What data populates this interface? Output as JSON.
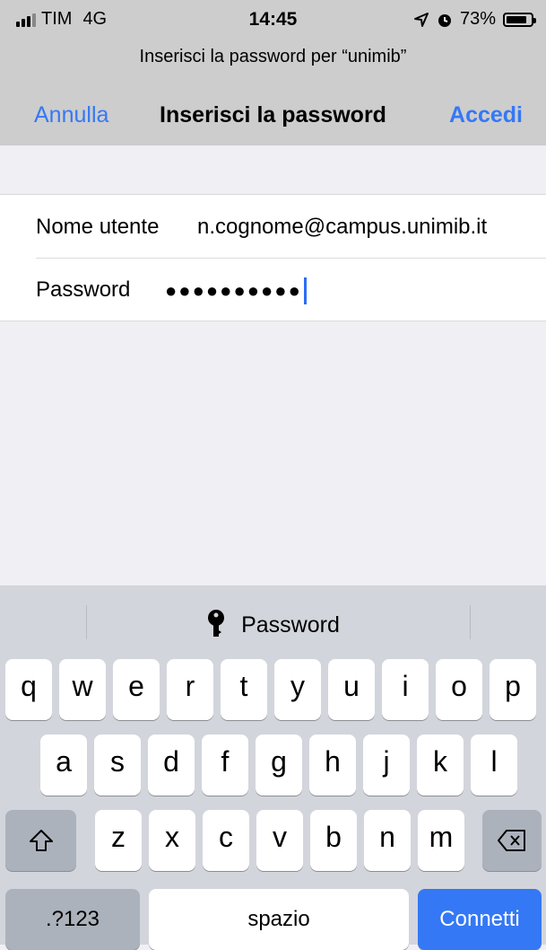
{
  "status": {
    "carrier": "TIM",
    "network": "4G",
    "time": "14:45",
    "battery": "73%"
  },
  "prompt": "Inserisci la password per “unimib”",
  "nav": {
    "cancel": "Annulla",
    "title": "Inserisci la password",
    "login": "Accedi"
  },
  "form": {
    "username_label": "Nome utente",
    "username_value": "n.cognome@campus.unimib.it",
    "password_label": "Password",
    "password_masked": "●●●●●●●●●●"
  },
  "keyboard": {
    "suggestion": "Password",
    "row1": [
      "q",
      "w",
      "e",
      "r",
      "t",
      "y",
      "u",
      "i",
      "o",
      "p"
    ],
    "row2": [
      "a",
      "s",
      "d",
      "f",
      "g",
      "h",
      "j",
      "k",
      "l"
    ],
    "row3": [
      "z",
      "x",
      "c",
      "v",
      "b",
      "n",
      "m"
    ],
    "numbers_key": ".?123",
    "space_key": "spazio",
    "return_key": "Connetti"
  },
  "icons": [
    "signal-icon",
    "location-icon",
    "alarm-icon",
    "battery-icon",
    "key-icon",
    "shift-icon",
    "backspace-icon"
  ],
  "colors": {
    "accent": "#3478f6",
    "header_bg": "#cdcdcd",
    "keyboard_bg": "#d2d5db"
  }
}
